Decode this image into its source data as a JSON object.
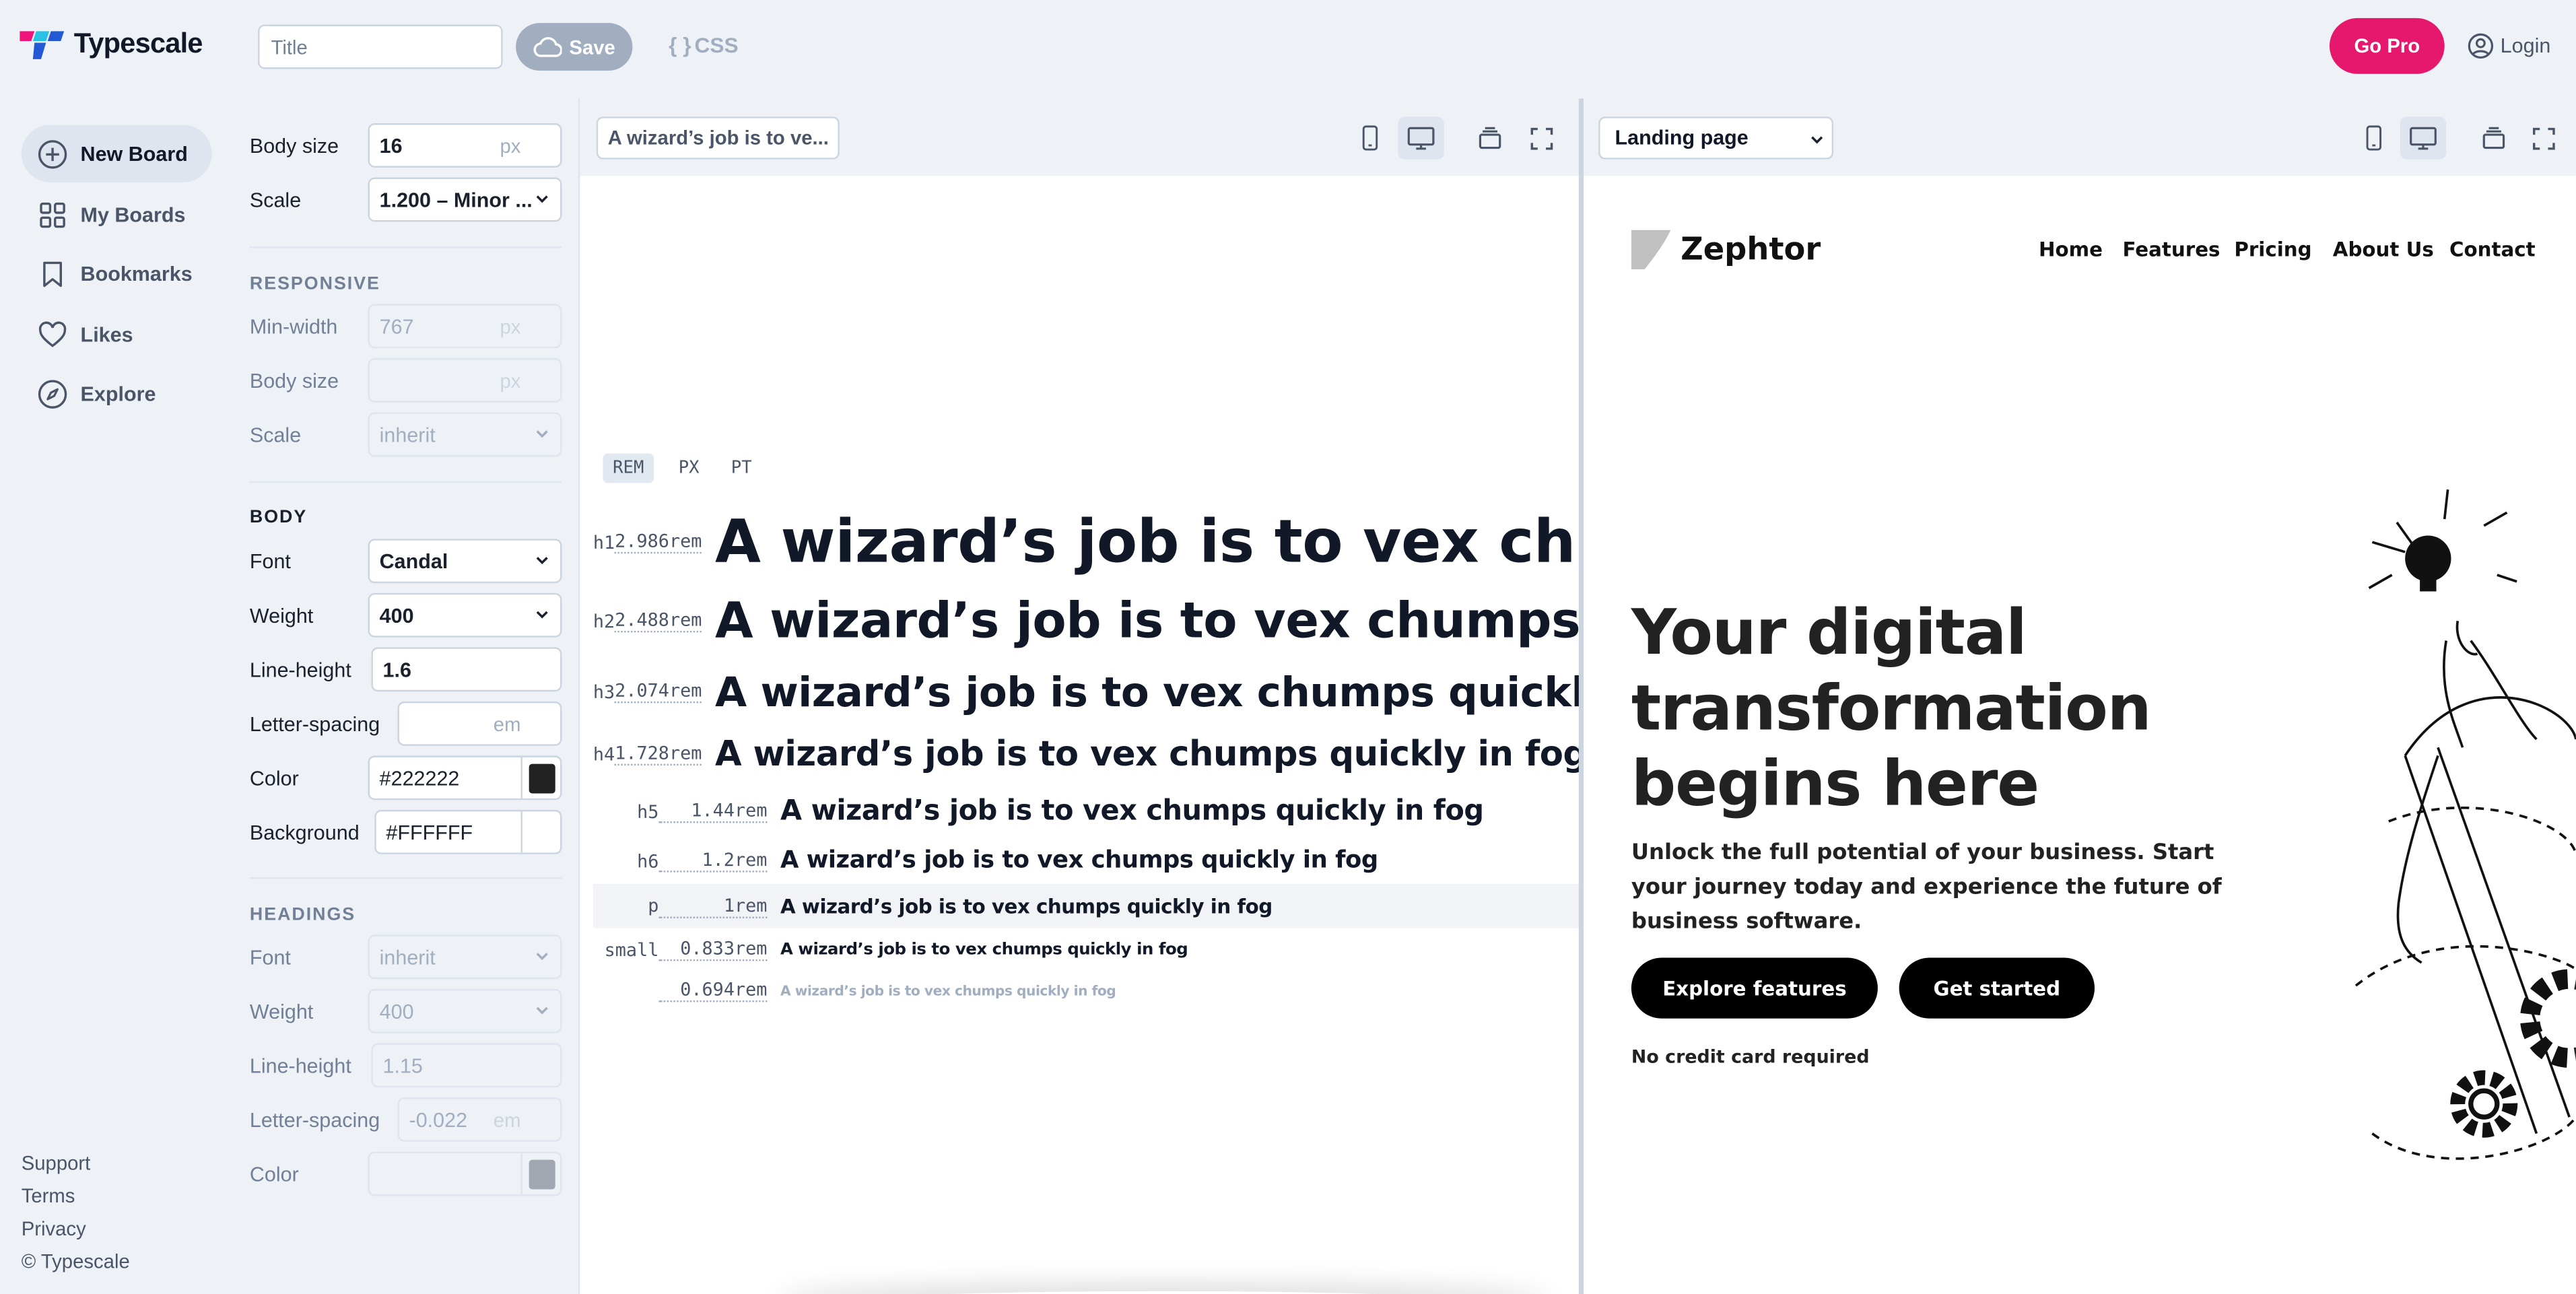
{
  "app": {
    "name": "Typescale"
  },
  "topbar": {
    "title_placeholder": "Title",
    "save_label": "Save",
    "css_label": "CSS",
    "gopro_label": "Go Pro",
    "login_label": "Login"
  },
  "sidebar": {
    "items": [
      {
        "label": "New Board",
        "icon": "plus-circle-icon"
      },
      {
        "label": "My Boards",
        "icon": "grid-icon"
      },
      {
        "label": "Bookmarks",
        "icon": "bookmark-icon"
      },
      {
        "label": "Likes",
        "icon": "heart-icon"
      },
      {
        "label": "Explore",
        "icon": "compass-icon"
      }
    ],
    "footer": [
      "Support",
      "Terms",
      "Privacy",
      "© Typescale"
    ]
  },
  "settings": {
    "body_size": {
      "label": "Body size",
      "value": "16",
      "unit": "px"
    },
    "scale": {
      "label": "Scale",
      "value": "1.200 – Minor ..."
    },
    "responsive": {
      "heading": "RESPONSIVE",
      "min_width": {
        "label": "Min-width",
        "placeholder": "767",
        "unit": "px"
      },
      "body_size": {
        "label": "Body size",
        "unit": "px"
      },
      "scale": {
        "label": "Scale",
        "value": "inherit"
      }
    },
    "body": {
      "heading": "BODY",
      "font": {
        "label": "Font",
        "value": "Candal"
      },
      "weight": {
        "label": "Weight",
        "value": "400"
      },
      "line_height": {
        "label": "Line-height",
        "value": "1.6"
      },
      "letter_spacing": {
        "label": "Letter-spacing",
        "unit": "em"
      },
      "color": {
        "label": "Color",
        "value": "#222222"
      },
      "background": {
        "label": "Background",
        "value": "#FFFFFF"
      }
    },
    "headings": {
      "heading": "HEADINGS",
      "font": {
        "label": "Font",
        "value": "inherit"
      },
      "weight": {
        "label": "Weight",
        "value": "400"
      },
      "line_height": {
        "label": "Line-height",
        "value": "1.15"
      },
      "letter_spacing": {
        "label": "Letter-spacing",
        "value": "-0.022",
        "unit": "em"
      },
      "color": {
        "label": "Color"
      }
    }
  },
  "preview": {
    "sample_text": "A wizard’s job is to ve...",
    "units": [
      "REM",
      "PX",
      "PT"
    ],
    "sample": "A wizard’s job is to vex chumps quickly in fog",
    "rows": [
      {
        "tag": "h1",
        "value": "2.986rem"
      },
      {
        "tag": "h2",
        "value": "2.488rem"
      },
      {
        "tag": "h3",
        "value": "2.074rem"
      },
      {
        "tag": "h4",
        "value": "1.728rem"
      },
      {
        "tag": "h5",
        "value": "1.44rem"
      },
      {
        "tag": "h6",
        "value": "1.2rem"
      },
      {
        "tag": "p",
        "value": "1rem"
      },
      {
        "tag": "small",
        "value": "0.833rem"
      },
      {
        "tag": "",
        "value": "0.694rem"
      }
    ]
  },
  "landing": {
    "template": "Landing page",
    "brand": "Zephtor",
    "menu": [
      "Home",
      "Features",
      "Pricing",
      "About Us",
      "Contact"
    ],
    "hero_title": "Your digital transformation begins here",
    "hero_subtitle": "Unlock the full potential of your business. Start your journey today and experience the future of business software.",
    "cta_primary": "Explore features",
    "cta_secondary": "Get started",
    "note": "No credit card required"
  },
  "colors": {
    "accent": "#e5186e",
    "logo_pink": "#f0147a",
    "logo_cyan": "#29c2e6",
    "logo_blue": "#2459d6"
  }
}
